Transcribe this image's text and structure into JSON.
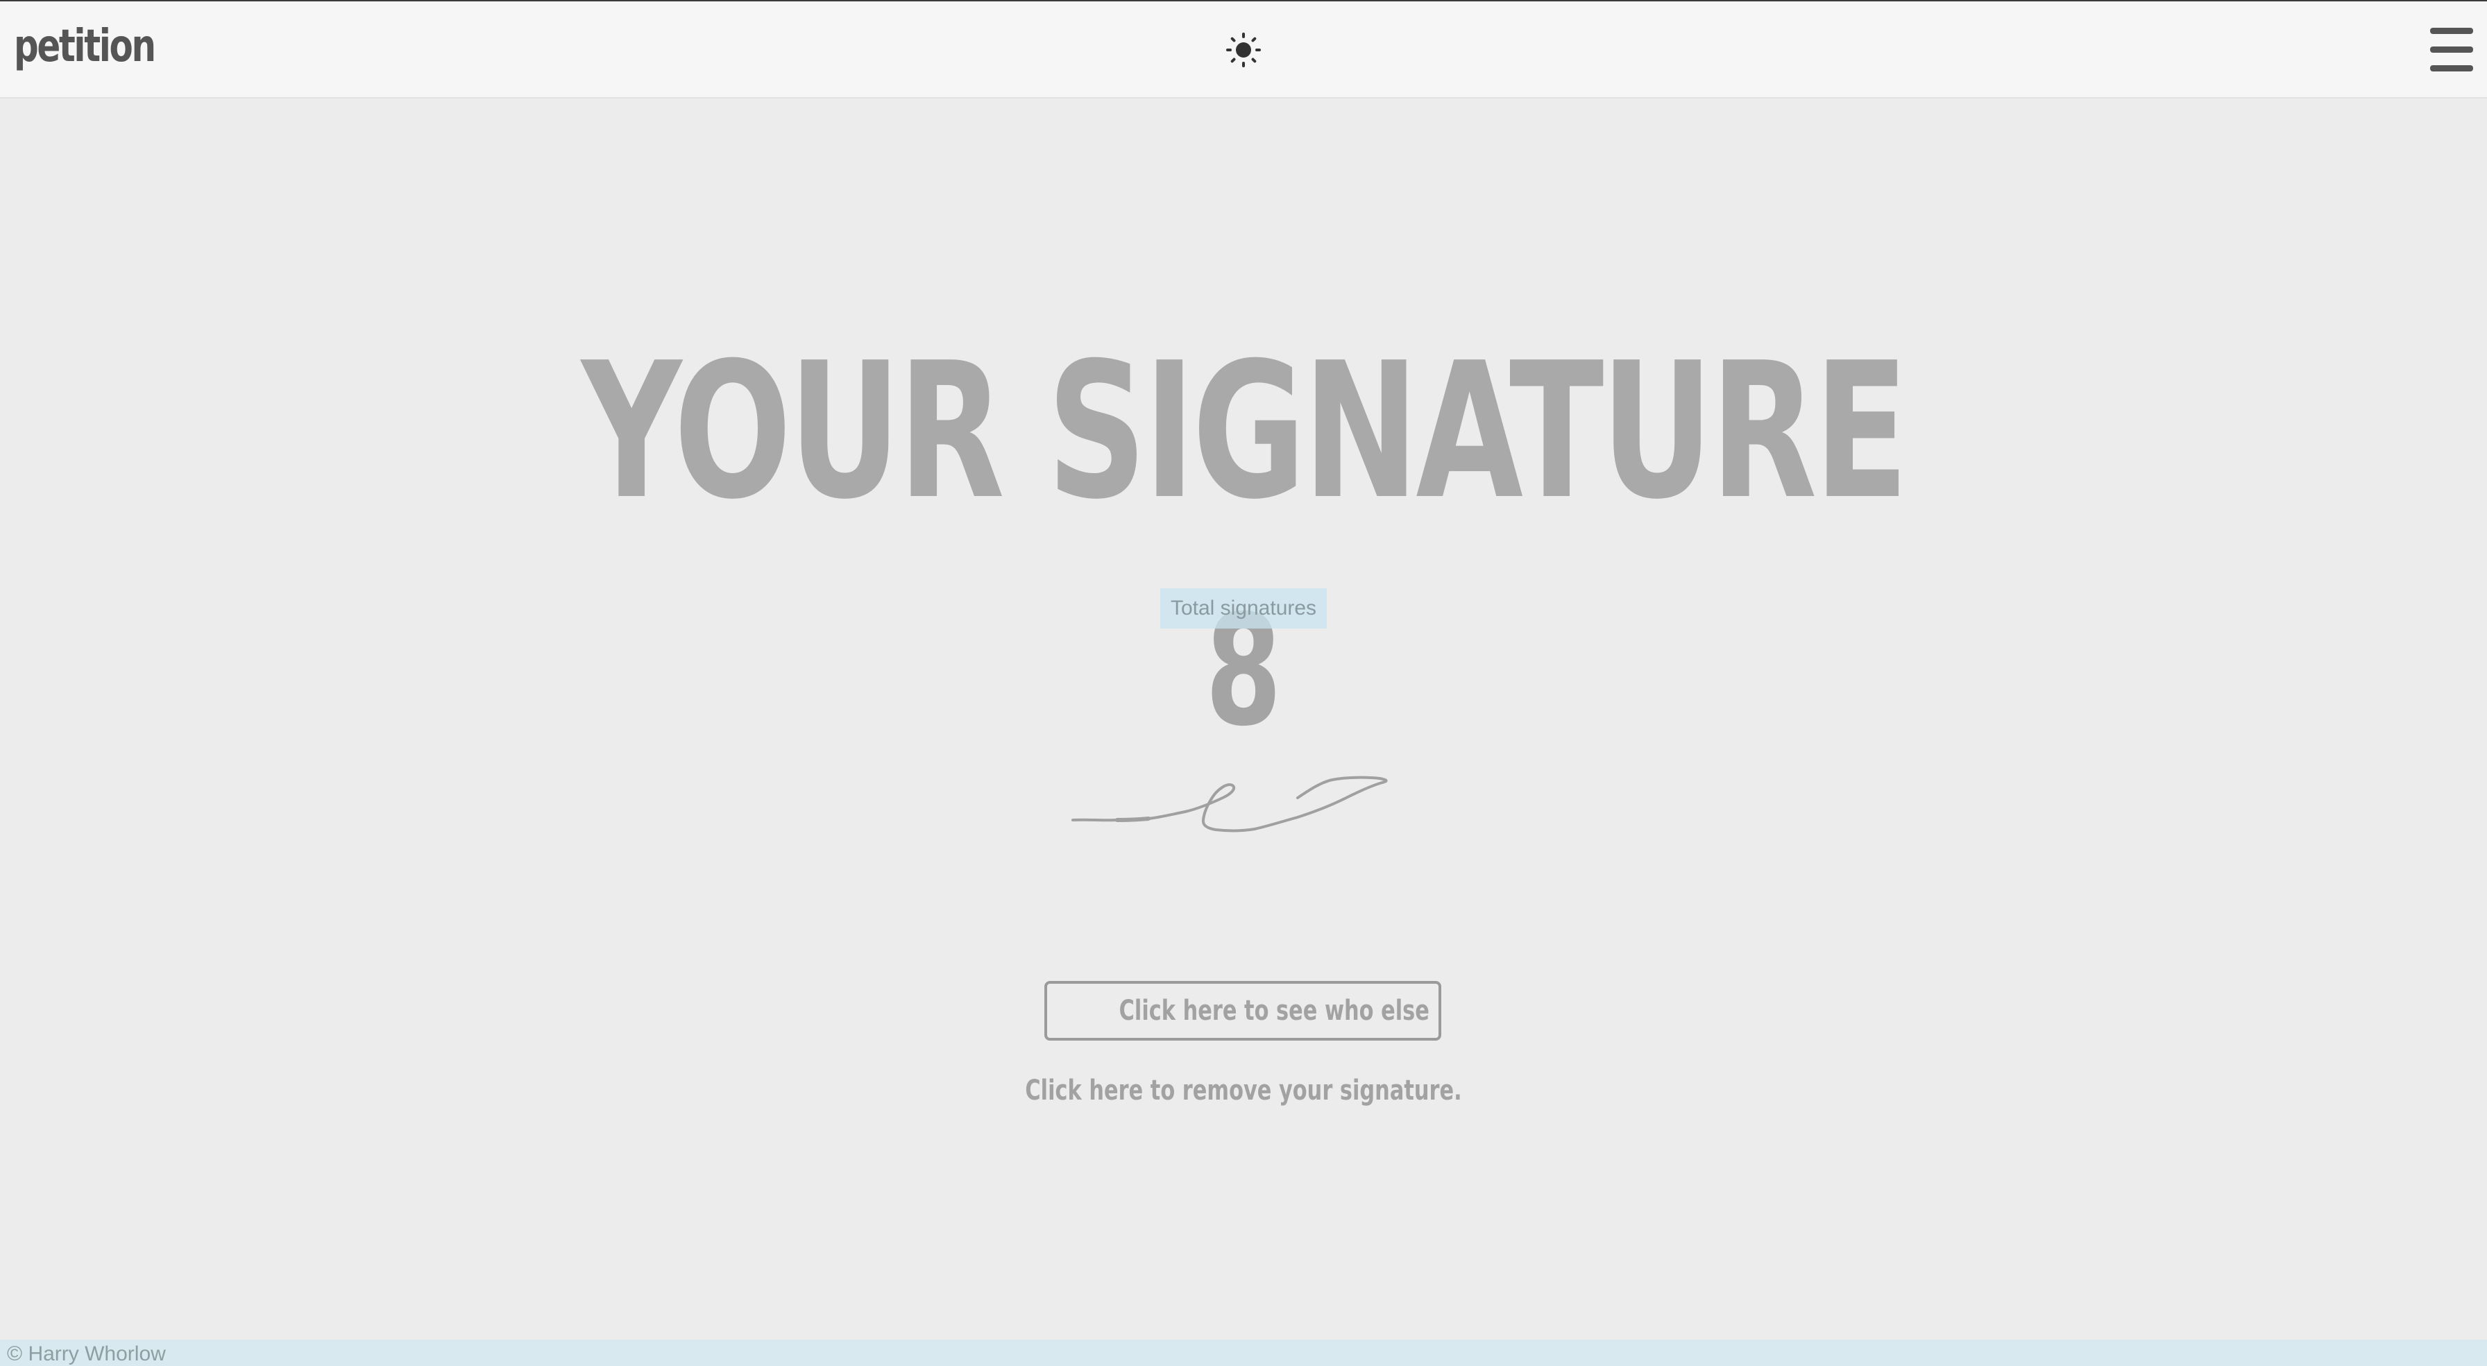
{
  "header": {
    "brand": "petition",
    "theme_toggle_icon": "sun-icon",
    "menu_icon": "hamburger-menu-icon"
  },
  "main": {
    "title": "YOUR SIGNATURE",
    "count_label": "Total signatures",
    "count_value": "8",
    "signature_image": "handwritten-signature",
    "involved_button_label": "Click here to see who else is involved!",
    "remove_link_label": "Click here to remove your signature."
  },
  "footer": {
    "copyright": "© Harry Whorlow"
  },
  "colors": {
    "background": "#ececec",
    "topbar": "#f6f6f6",
    "text_muted": "#a9a9a9",
    "footer_bg": "#d8eaef",
    "label_highlight": "#c8e4f0"
  }
}
